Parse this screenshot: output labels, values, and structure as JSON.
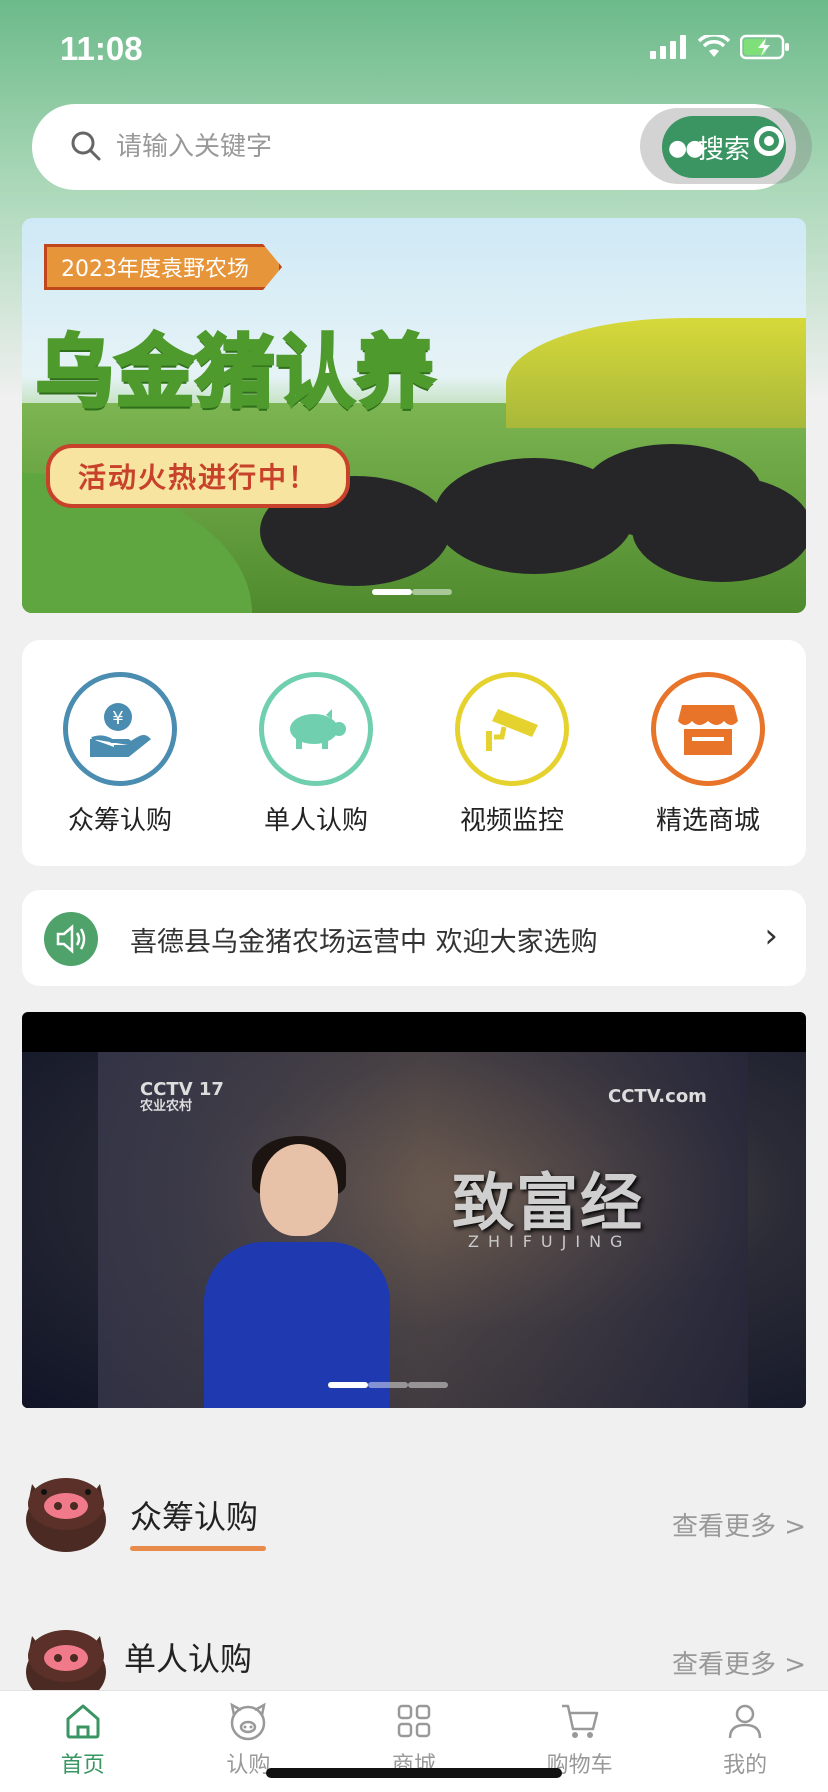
{
  "status_bar": {
    "time": "11:08"
  },
  "search": {
    "placeholder": "请输入关键字",
    "button_label": "搜索"
  },
  "banner": {
    "tag": "2023年度袁野农场",
    "title": "乌金猪认养",
    "pill": "活动火热进行中！"
  },
  "categories": [
    {
      "label": "众筹认购",
      "icon": "yen-hand-icon",
      "color": "#4a8db0"
    },
    {
      "label": "单人认购",
      "icon": "pig-icon",
      "color": "#6fcfae"
    },
    {
      "label": "视频监控",
      "icon": "camera-icon",
      "color": "#e6d22e"
    },
    {
      "label": "精选商城",
      "icon": "shop-icon",
      "color": "#e8742a"
    }
  ],
  "notice": {
    "text": "喜德县乌金猪农场运营中 欢迎大家选购"
  },
  "video": {
    "channel_logo": "CCTV 17",
    "channel_sub": "农业农村",
    "site_logo": "CCTV.com",
    "show_title": "致富经",
    "show_sub": "ZHIFUJING"
  },
  "sections": [
    {
      "title": "众筹认购",
      "more": "查看更多 >"
    },
    {
      "title": "单人认购",
      "more": "查看更多 >"
    }
  ],
  "tabbar": [
    {
      "label": "首页",
      "icon": "home-icon",
      "active": true
    },
    {
      "label": "认购",
      "icon": "pig-face-icon",
      "active": false
    },
    {
      "label": "商城",
      "icon": "grid-icon",
      "active": false
    },
    {
      "label": "购物车",
      "icon": "cart-icon",
      "active": false
    },
    {
      "label": "我的",
      "icon": "user-icon",
      "active": false
    }
  ],
  "colors": {
    "brand_green": "#3a9563",
    "accent_orange": "#e88a4a"
  }
}
